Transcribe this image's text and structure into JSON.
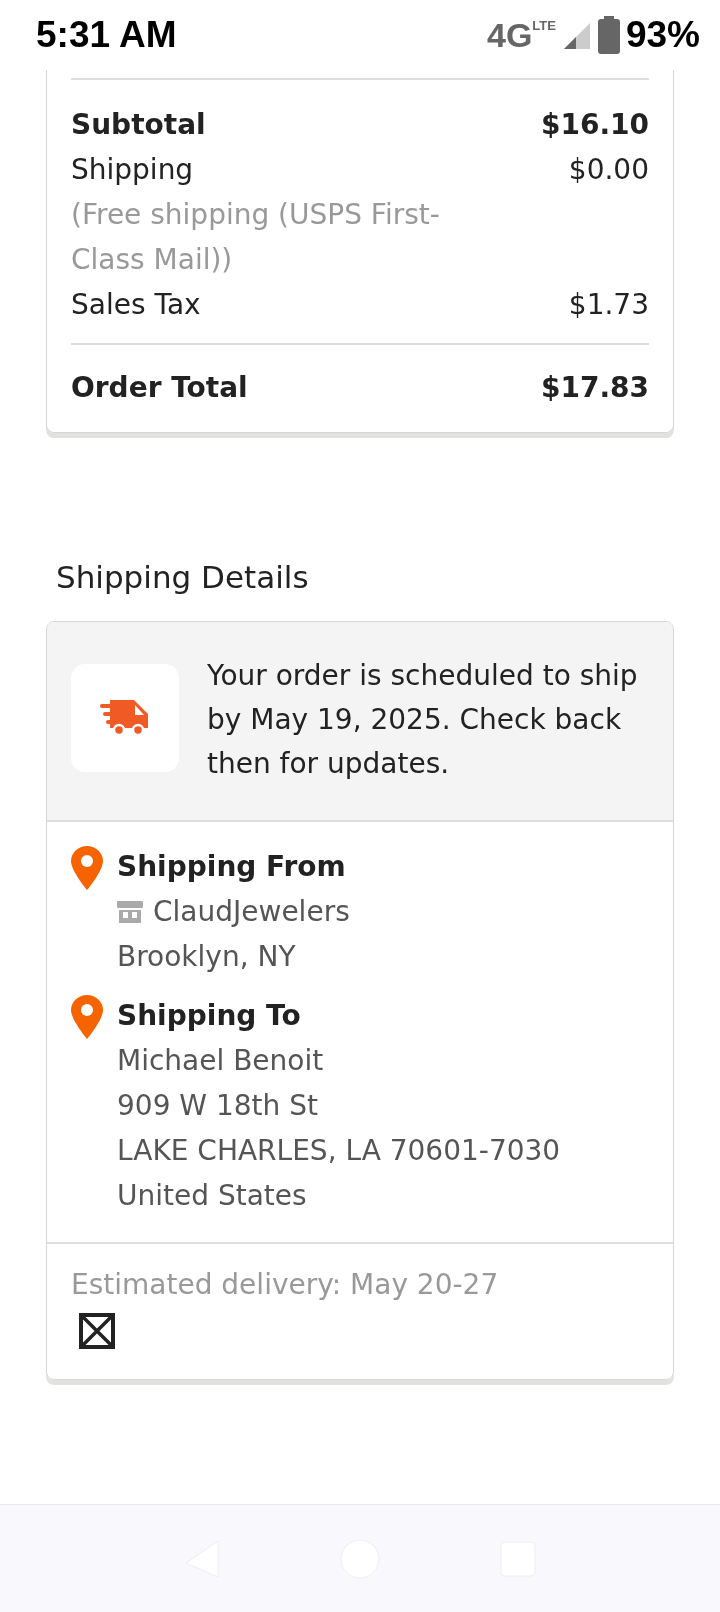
{
  "status_bar": {
    "time": "5:31 AM",
    "network": "4G",
    "network_sup": "LTE",
    "battery": "93%"
  },
  "summary": {
    "rows": [
      {
        "kind": "bold",
        "label": "Subtotal",
        "value": "$16.10"
      },
      {
        "kind": "normal",
        "label": "Shipping",
        "value": "$0.00",
        "note": "(Free shipping (USPS First-Class Mail))"
      },
      {
        "kind": "normal",
        "label": "Sales Tax",
        "value": "$1.73"
      }
    ],
    "total": {
      "label": "Order Total",
      "value": "$17.83"
    }
  },
  "shipping_details": {
    "title": "Shipping Details",
    "notice": "Your order is scheduled to ship by May 19, 2025. Check back then for updates.",
    "from": {
      "title": "Shipping From",
      "shop": "ClaudJewelers",
      "lines": [
        "Brooklyn, NY"
      ]
    },
    "to": {
      "title": "Shipping To",
      "lines": [
        "Michael Benoit",
        "909 W 18th St",
        "LAKE CHARLES, LA 70601-7030",
        "United States"
      ]
    },
    "estimate": "Estimated delivery: May 20-27"
  }
}
